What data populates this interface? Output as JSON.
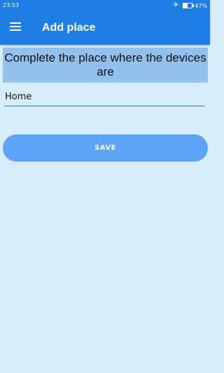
{
  "statusbar": {
    "time": "23:53",
    "battery_text": "47%",
    "battery_level": 0.47,
    "icons": [
      "airplane-mode-icon",
      "battery-icon"
    ]
  },
  "appbar": {
    "title": "Add place",
    "menu_icon": "hamburger-menu-icon"
  },
  "prompt": {
    "text": "Complete the place where the devices are"
  },
  "place_input": {
    "value": "Home"
  },
  "save_button": {
    "label": "SAVE"
  },
  "colors": {
    "primary": "#1e7ee6",
    "background": "#d6eefc",
    "prompt_bg": "#92c1ee",
    "button": "#5da3f6"
  }
}
